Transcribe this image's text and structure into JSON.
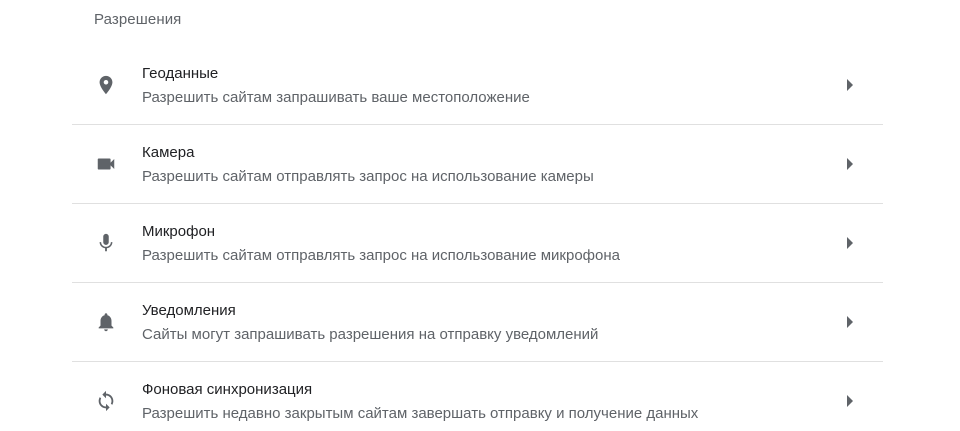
{
  "section": {
    "title": "Разрешения"
  },
  "items": [
    {
      "icon": "location-pin-icon",
      "title": "Геоданные",
      "subtitle": "Разрешить сайтам запрашивать ваше местоположение"
    },
    {
      "icon": "videocam-icon",
      "title": "Камера",
      "subtitle": "Разрешить сайтам отправлять запрос на использование камеры"
    },
    {
      "icon": "microphone-icon",
      "title": "Микрофон",
      "subtitle": "Разрешить сайтам отправлять запрос на использование микрофона"
    },
    {
      "icon": "bell-icon",
      "title": "Уведомления",
      "subtitle": "Сайты могут запрашивать разрешения на отправку уведомлений"
    },
    {
      "icon": "sync-icon",
      "title": "Фоновая синхронизация",
      "subtitle": "Разрешить недавно закрытым сайтам завершать отправку и получение данных"
    }
  ]
}
